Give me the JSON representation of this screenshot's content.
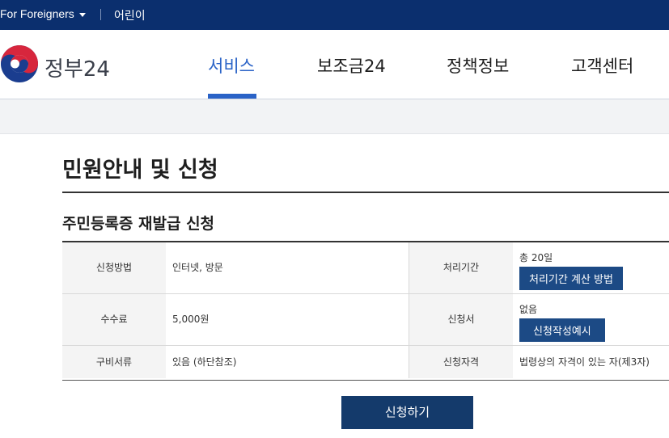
{
  "topbar": {
    "foreigners_label": "For Foreigners",
    "kids_label": "어린이"
  },
  "logo": {
    "brand": "정부24"
  },
  "nav": {
    "items": [
      {
        "label": "서비스"
      },
      {
        "label": "보조금24"
      },
      {
        "label": "정책정보"
      },
      {
        "label": "고객센터"
      }
    ]
  },
  "page": {
    "title": "민원안내 및 신청",
    "subtitle": "주민등록증 재발급 신청"
  },
  "info": {
    "method_label": "신청방법",
    "method_value": "인터넷, 방문",
    "period_label": "처리기간",
    "period_value": "총 20일",
    "period_button": "처리기간 계산 방법",
    "fee_label": "수수료",
    "fee_value": "5,000원",
    "form_label": "신청서",
    "form_value": "없음",
    "form_button": "신청작성예시",
    "docs_label": "구비서류",
    "docs_value": "있음 (하단참조)",
    "qual_label": "신청자격",
    "qual_value": "법령상의 자격이 있는 자(제3자)"
  },
  "actions": {
    "apply_label": "신청하기"
  },
  "colors": {
    "topbar": "#0b2f6e",
    "accent": "#2a63c7",
    "button": "#1c4a85",
    "apply_button": "#143a6b"
  }
}
